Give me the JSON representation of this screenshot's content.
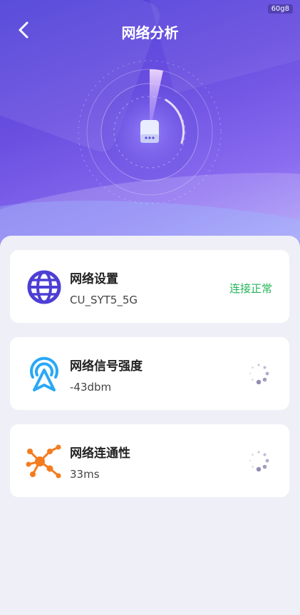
{
  "header": {
    "title": "网络分析",
    "badge": "60g8"
  },
  "colors": {
    "accent": "#5b4ce0",
    "ok_green": "#25b45a",
    "signal_blue": "#2aa8f5",
    "connect_orange": "#f47c20"
  },
  "cards": [
    {
      "name": "网络设置",
      "value": "CU_SYT5_5G",
      "status": "连接正常",
      "icon": "globe-icon"
    },
    {
      "name": "网络信号强度",
      "value": "-43dbm",
      "icon": "signal-tower-icon"
    },
    {
      "name": "网络连通性",
      "value": "33ms",
      "icon": "network-hub-icon"
    }
  ]
}
